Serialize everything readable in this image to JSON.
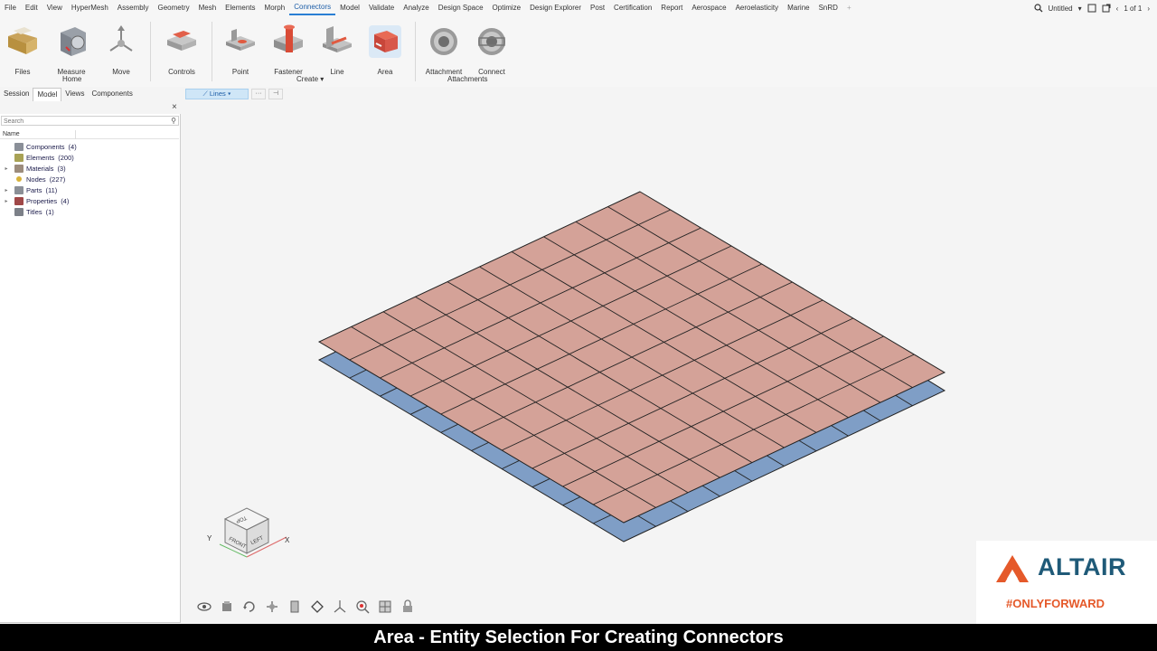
{
  "menubar": {
    "items": [
      "File",
      "Edit",
      "View",
      "HyperMesh",
      "Assembly",
      "Geometry",
      "Mesh",
      "Elements",
      "Morph",
      "Connectors",
      "Model",
      "Validate",
      "Analyze",
      "Design Space",
      "Optimize",
      "Design Explorer",
      "Post",
      "Certification",
      "Report",
      "Aerospace",
      "Aeroelasticity",
      "Marine",
      "SnRD"
    ],
    "active_index": 9,
    "right": {
      "doc_title": "Untitled",
      "page": "1 of 1"
    }
  },
  "ribbon": {
    "buttons": {
      "files": "Files",
      "measure": "Measure",
      "move": "Move",
      "controls": "Controls",
      "point": "Point",
      "fastener": "Fastener",
      "line": "Line",
      "area": "Area",
      "attachment": "Attachment",
      "connect": "Connect"
    },
    "groups": {
      "home": "Home",
      "create": "Create",
      "attachments": "Attachments"
    }
  },
  "left_panel": {
    "tabs": [
      "Session",
      "Model",
      "Views",
      "Components"
    ],
    "active_tab": 1,
    "search_placeholder": "Search",
    "column_name": "Name",
    "tree": [
      {
        "label": "Components",
        "count": "(4)",
        "icon": "components-icon",
        "color": "#8a8f98",
        "expandable": false
      },
      {
        "label": "Elements",
        "count": "(200)",
        "icon": "elements-icon",
        "color": "#a8a255",
        "expandable": false
      },
      {
        "label": "Materials",
        "count": "(3)",
        "icon": "materials-icon",
        "color": "#9c8c7c",
        "expandable": true
      },
      {
        "label": "Nodes",
        "count": "(227)",
        "icon": "nodes-icon",
        "color": "#d7b23a",
        "expandable": false
      },
      {
        "label": "Parts",
        "count": "(11)",
        "icon": "parts-icon",
        "color": "#8b8f96",
        "expandable": true
      },
      {
        "label": "Properties",
        "count": "(4)",
        "icon": "properties-icon",
        "color": "#a04848",
        "expandable": true
      },
      {
        "label": "Titles",
        "count": "(1)",
        "icon": "titles-icon",
        "color": "#7c8088",
        "expandable": false
      }
    ]
  },
  "view_toolbar": {
    "selector_label": "Lines",
    "more_label": "···",
    "end_label": "⊣"
  },
  "viewcube": {
    "front": "FRONT",
    "left": "LEFT",
    "top": "TOP",
    "axis_x": "X",
    "axis_y": "Y"
  },
  "mesh": {
    "top_plate_color": "#d4a298",
    "bottom_plate_color": "#7f9ec6",
    "grid_divisions": 10
  },
  "logo": {
    "name": "ALTAIR",
    "tagline": "#ONLYFORWARD",
    "brand_color": "#1f5a78",
    "accent_color": "#e5592a"
  },
  "caption": "Area - Entity Selection For Creating Connectors"
}
